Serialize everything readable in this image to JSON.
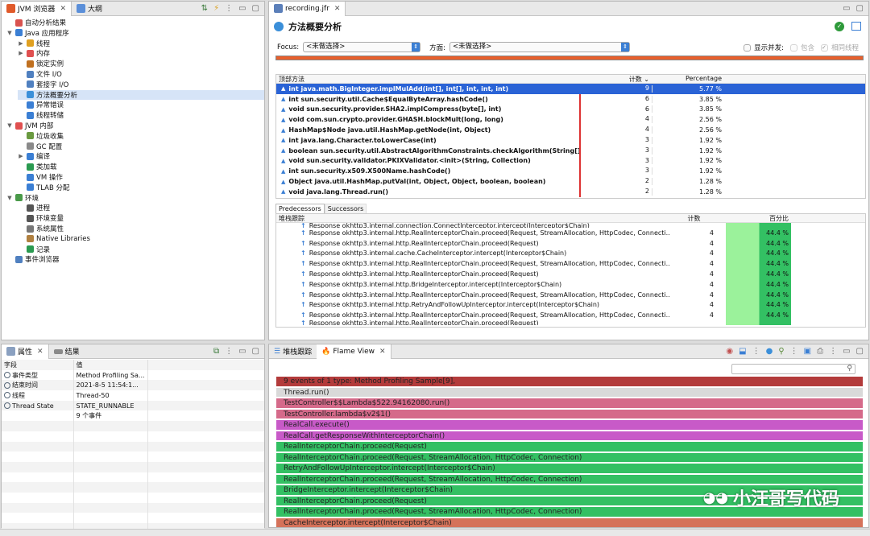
{
  "left_tabs": [
    "JVM 浏览器",
    "大纲"
  ],
  "tree": [
    {
      "label": "自动分析结果",
      "level": 0,
      "icon": "report-icon",
      "color": "#d9534f",
      "tw": ""
    },
    {
      "label": "Java 应用程序",
      "level": 0,
      "icon": "java-app-icon",
      "color": "#3b7fd4",
      "tw": "▼"
    },
    {
      "label": "线程",
      "level": 1,
      "icon": "threads-icon",
      "color": "#e0a020",
      "tw": "▶"
    },
    {
      "label": "内存",
      "level": 1,
      "icon": "memory-icon",
      "color": "#e05050",
      "tw": "▶"
    },
    {
      "label": "锁定实例",
      "level": 1,
      "icon": "lock-icon",
      "color": "#c07020",
      "tw": ""
    },
    {
      "label": "文件 I/O",
      "level": 1,
      "icon": "file-io-icon",
      "color": "#5080c0",
      "tw": ""
    },
    {
      "label": "套接字 I/O",
      "level": 1,
      "icon": "socket-io-icon",
      "color": "#5080c0",
      "tw": ""
    },
    {
      "label": "方法概要分析",
      "level": 1,
      "icon": "method-profiling-icon",
      "color": "#3b8fd9",
      "tw": "",
      "selected": true
    },
    {
      "label": "异常错误",
      "level": 1,
      "icon": "exception-icon",
      "color": "#3b7fd4",
      "tw": ""
    },
    {
      "label": "线程转储",
      "level": 1,
      "icon": "thread-dump-icon",
      "color": "#3b7fd4",
      "tw": ""
    },
    {
      "label": "JVM 内部",
      "level": 0,
      "icon": "jvm-internals-icon",
      "color": "#e05050",
      "tw": "▼"
    },
    {
      "label": "垃圾收集",
      "level": 1,
      "icon": "gc-icon",
      "color": "#6a9a40",
      "tw": ""
    },
    {
      "label": "GC 配置",
      "level": 1,
      "icon": "gc-config-icon",
      "color": "#8a8a8a",
      "tw": ""
    },
    {
      "label": "编译",
      "level": 1,
      "icon": "compile-icon",
      "color": "#3b7fd4",
      "tw": "▶"
    },
    {
      "label": "类加载",
      "level": 1,
      "icon": "class-loading-icon",
      "color": "#2a9a50",
      "tw": ""
    },
    {
      "label": "VM 操作",
      "level": 1,
      "icon": "vm-operation-icon",
      "color": "#3b7fd4",
      "tw": ""
    },
    {
      "label": "TLAB 分配",
      "level": 1,
      "icon": "tlab-icon",
      "color": "#3b7fd4",
      "tw": ""
    },
    {
      "label": "环境",
      "level": 0,
      "icon": "environment-icon",
      "color": "#4a9a4a",
      "tw": "▼"
    },
    {
      "label": "进程",
      "level": 1,
      "icon": "process-icon",
      "color": "#555",
      "tw": ""
    },
    {
      "label": "环境变量",
      "level": 1,
      "icon": "env-var-icon",
      "color": "#555",
      "tw": ""
    },
    {
      "label": "系统属性",
      "level": 1,
      "icon": "system-props-icon",
      "color": "#777",
      "tw": ""
    },
    {
      "label": "Native Libraries",
      "level": 1,
      "icon": "native-lib-icon",
      "color": "#b08040",
      "tw": ""
    },
    {
      "label": "记录",
      "level": 1,
      "icon": "recording-icon",
      "color": "#2a9a50",
      "tw": ""
    },
    {
      "label": "事件浏览器",
      "level": 0,
      "icon": "event-browser-icon",
      "color": "#5080c0",
      "tw": ""
    }
  ],
  "props_tabs": [
    "属性",
    "结果"
  ],
  "props_headers": [
    "字段",
    "值"
  ],
  "props_rows": [
    {
      "field": "事件类型",
      "value": "Method Profiling Sa..."
    },
    {
      "field": "结束时间",
      "value": "2021-8-5 11:54:1..."
    },
    {
      "field": "线程",
      "value": "Thread-50"
    },
    {
      "field": "Thread State",
      "value": "STATE_RUNNABLE"
    },
    {
      "field": "",
      "value": "9 个事件"
    }
  ],
  "editor": {
    "tab": "recording.jfr",
    "title": "方法概要分析",
    "focus_label": "Focus:",
    "focus_value": "<未做选择>",
    "aspect_label": "方面:",
    "aspect_value": "<未做选择>",
    "show_concurrent": "显示并发:",
    "include": "包含",
    "same_thread": "相同线程"
  },
  "top_methods": {
    "headers": {
      "method": "顶部方法",
      "count": "计数",
      "percentage": "Percentage"
    },
    "rows": [
      {
        "method": "int java.math.BigInteger.implMulAdd(int[], int[], int, int, int)",
        "count": "9",
        "pct": "5.77 %",
        "frac": 1.0
      },
      {
        "method": "int sun.security.util.Cache$EqualByteArray.hashCode()",
        "count": "6",
        "pct": "3.85 %",
        "frac": 0.667
      },
      {
        "method": "void sun.security.provider.SHA2.implCompress(byte[], int)",
        "count": "6",
        "pct": "3.85 %",
        "frac": 0.667
      },
      {
        "method": "void com.sun.crypto.provider.GHASH.blockMult(long, long)",
        "count": "4",
        "pct": "2.56 %",
        "frac": 0.444
      },
      {
        "method": "HashMap$Node java.util.HashMap.getNode(int, Object)",
        "count": "4",
        "pct": "2.56 %",
        "frac": 0.444
      },
      {
        "method": "int java.lang.Character.toLowerCase(int)",
        "count": "3",
        "pct": "1.92 %",
        "frac": 0.333
      },
      {
        "method": "boolean sun.security.util.AbstractAlgorithmConstraints.checkAlgorithm(String[], S...",
        "count": "3",
        "pct": "1.92 %",
        "frac": 0.333
      },
      {
        "method": "void sun.security.validator.PKIXValidator.<init>(String, Collection)",
        "count": "3",
        "pct": "1.92 %",
        "frac": 0.333
      },
      {
        "method": "int sun.security.x509.X500Name.hashCode()",
        "count": "3",
        "pct": "1.92 %",
        "frac": 0.333
      },
      {
        "method": "Object java.util.HashMap.putVal(int, Object, Object, boolean, boolean)",
        "count": "2",
        "pct": "1.28 %",
        "frac": 0.222
      },
      {
        "method": "void java.lang.Thread.run()",
        "count": "2",
        "pct": "1.28 %",
        "frac": 0.222
      }
    ]
  },
  "sub_tabs": [
    "Predecessors",
    "Successors"
  ],
  "stack": {
    "headers": {
      "trace": "堆栈跟踪",
      "count": "计数",
      "percent": "百分比"
    },
    "partial_top": "Response okhttp3.internal.connection.ConnectInterceptor.intercept(Interceptor$Chain)",
    "rows": [
      {
        "trace": "Response okhttp3.internal.http.RealInterceptorChain.proceed(Request, StreamAllocation, HttpCodec, Connecti...",
        "count": "4",
        "pct": "44.4 %"
      },
      {
        "trace": "Response okhttp3.internal.http.RealInterceptorChain.proceed(Request)",
        "count": "4",
        "pct": "44.4 %"
      },
      {
        "trace": "Response okhttp3.internal.cache.CacheInterceptor.intercept(Interceptor$Chain)",
        "count": "4",
        "pct": "44.4 %"
      },
      {
        "trace": "Response okhttp3.internal.http.RealInterceptorChain.proceed(Request, StreamAllocation, HttpCodec, Connecti...",
        "count": "4",
        "pct": "44.4 %"
      },
      {
        "trace": "Response okhttp3.internal.http.RealInterceptorChain.proceed(Request)",
        "count": "4",
        "pct": "44.4 %"
      },
      {
        "trace": "Response okhttp3.internal.http.BridgeInterceptor.intercept(Interceptor$Chain)",
        "count": "4",
        "pct": "44.4 %"
      },
      {
        "trace": "Response okhttp3.internal.http.RealInterceptorChain.proceed(Request, StreamAllocation, HttpCodec, Connecti...",
        "count": "4",
        "pct": "44.4 %"
      },
      {
        "trace": "Response okhttp3.internal.http.RetryAndFollowUpInterceptor.intercept(Interceptor$Chain)",
        "count": "4",
        "pct": "44.4 %"
      },
      {
        "trace": "Response okhttp3.internal.http.RealInterceptorChain.proceed(Request, StreamAllocation, HttpCodec, Connecti...",
        "count": "4",
        "pct": "44.4 %"
      }
    ],
    "partial_bottom": "Response okhttp3.internal.http.RealInterceptorChain.proceed(Request)"
  },
  "bottom_tabs": [
    "堆栈跟踪",
    "Flame View"
  ],
  "flame": [
    {
      "label": "9 events of 1 type: Method Profiling Sample[9],",
      "color": "#b33b3b",
      "text": "#222"
    },
    {
      "label": "Thread.run()",
      "color": "#d9d9d9",
      "text": "#222"
    },
    {
      "label": "TestController$$Lambda$522.94162080.run()",
      "color": "#d56a8a",
      "text": "#222"
    },
    {
      "label": "TestController.lambda$v2$1()",
      "color": "#d56a8a",
      "text": "#222"
    },
    {
      "label": "RealCall.execute()",
      "color": "#c85ac8",
      "text": "#222"
    },
    {
      "label": "RealCall.getResponseWithInterceptorChain()",
      "color": "#c85ac8",
      "text": "#222"
    },
    {
      "label": "RealInterceptorChain.proceed(Request)",
      "color": "#33c063",
      "text": "#222"
    },
    {
      "label": "RealInterceptorChain.proceed(Request, StreamAllocation, HttpCodec, Connection)",
      "color": "#33c063",
      "text": "#222"
    },
    {
      "label": "RetryAndFollowUpInterceptor.intercept(Interceptor$Chain)",
      "color": "#33c063",
      "text": "#222"
    },
    {
      "label": "RealInterceptorChain.proceed(Request, StreamAllocation, HttpCodec, Connection)",
      "color": "#33c063",
      "text": "#222"
    },
    {
      "label": "BridgeInterceptor.intercept(Interceptor$Chain)",
      "color": "#33c063",
      "text": "#222"
    },
    {
      "label": "RealInterceptorChain.proceed(Request)",
      "color": "#33c063",
      "text": "#222"
    },
    {
      "label": "RealInterceptorChain.proceed(Request, StreamAllocation, HttpCodec, Connection)",
      "color": "#33c063",
      "text": "#222"
    },
    {
      "label": "CacheInterceptor.intercept(Interceptor$Chain)",
      "color": "#d5725a",
      "text": "#222"
    }
  ],
  "watermark": "小汪哥写代码"
}
